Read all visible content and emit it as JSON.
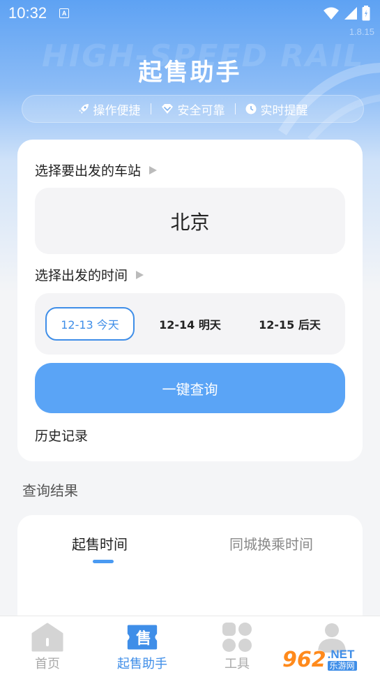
{
  "status_bar": {
    "time": "10:32",
    "notif_letter": "A"
  },
  "hero": {
    "watermark": "HIGH-SPEED RAIL",
    "version": "1.8.15",
    "title": "起售助手",
    "features": [
      "操作便捷",
      "安全可靠",
      "实时提醒"
    ]
  },
  "search": {
    "station_label": "选择要出发的车站",
    "station_value": "北京",
    "time_label": "选择出发的时间",
    "dates": [
      {
        "label": "12-13 今天",
        "selected": true
      },
      {
        "label": "12-14 明天",
        "selected": false
      },
      {
        "label": "12-15 后天",
        "selected": false
      }
    ],
    "query_button": "一键查询",
    "history": "历史记录"
  },
  "results": {
    "title": "查询结果",
    "tabs": [
      "起售时间",
      "同城换乘时间"
    ],
    "active_tab": 0
  },
  "tabbar": {
    "items": [
      {
        "label": "首页",
        "icon": "home-icon"
      },
      {
        "label": "起售助手",
        "icon": "ticket-icon",
        "icon_text": "售"
      },
      {
        "label": "工具",
        "icon": "tools-icon"
      },
      {
        "label": "",
        "icon": "user-icon"
      }
    ],
    "active_index": 1
  },
  "watermark": {
    "num": "962",
    "net": ".NET",
    "cn": "乐游网"
  },
  "colors": {
    "accent": "#3f8ee8",
    "button": "#5aa4f6",
    "hero_top": "#5ea2f3"
  }
}
